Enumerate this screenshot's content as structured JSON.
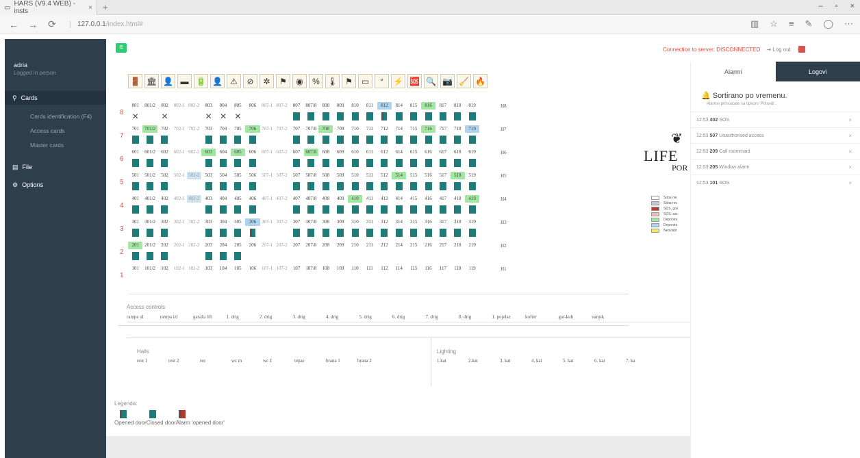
{
  "browser": {
    "tab_title": "HARS (V9.4 WEB) - insts",
    "tab_close": "×",
    "new_tab": "+",
    "url_host": "127.0.0.1",
    "url_path": "/index.html#",
    "back": "←",
    "forward": "→",
    "refresh": "⟳",
    "win_min": "–",
    "win_max": "▫",
    "win_close": "×"
  },
  "sidebar": {
    "user_name": "adria",
    "user_status": "Logged in person",
    "menu": [
      {
        "label": "Cards",
        "icon": "search-icon",
        "glyph": "🔍"
      },
      {
        "label": "Cards identification (F4)"
      },
      {
        "label": "Access cards"
      },
      {
        "label": "Master cards"
      },
      {
        "label": "File",
        "icon": "file-icon",
        "glyph": "▤"
      },
      {
        "label": "Options",
        "icon": "gear-icon",
        "glyph": "⚙"
      }
    ]
  },
  "header": {
    "connection_status": "Connection to server: DISCONNECTED",
    "logout_label": "Log out"
  },
  "toolbar_icons": [
    "door-icon",
    "building-icon",
    "person-icon",
    "bed-icon",
    "battery-icon",
    "person-icon",
    "warning-icon",
    "no-entry-icon",
    "fan-icon",
    "flag-icon",
    "dial-icon",
    "percent-icon",
    "thermo-icon",
    "flag-icon",
    "window-icon",
    "temp-icon",
    "lightning-icon",
    "sos-icon",
    "magnify-icon",
    "camera-icon",
    "maid-icon",
    "fire-icon"
  ],
  "floors": [
    {
      "floor": "8",
      "code": "H8",
      "rooms": [
        "801",
        "801/2",
        "802",
        "802-1",
        "802-2",
        "803",
        "804",
        "805",
        "806",
        "807-1",
        "807-2",
        "807",
        "807/8",
        "808",
        "809",
        "810",
        "811",
        "812",
        "814",
        "815",
        "816",
        "817",
        "818",
        "819"
      ],
      "hl": {
        "17": "b",
        "20": "g"
      }
    },
    {
      "floor": "7",
      "code": "H7",
      "rooms": [
        "701",
        "701/2",
        "702",
        "702-1",
        "702-2",
        "703",
        "704",
        "705",
        "706",
        "707-1",
        "707-2",
        "707",
        "707/8",
        "708",
        "709",
        "710",
        "711",
        "712",
        "714",
        "715",
        "716",
        "717",
        "718",
        "719"
      ],
      "hl": {
        "1": "g",
        "8": "g",
        "13": "g",
        "20": "g",
        "23": "b"
      }
    },
    {
      "floor": "6",
      "code": "H6",
      "rooms": [
        "601",
        "601/2",
        "602",
        "602-1",
        "602-2",
        "603",
        "604",
        "605",
        "606",
        "607-1",
        "607-2",
        "607",
        "607/8",
        "608",
        "609",
        "610",
        "611",
        "612",
        "614",
        "615",
        "616",
        "617",
        "618",
        "619"
      ],
      "hl": {
        "5": "g",
        "7": "g",
        "12": "g"
      }
    },
    {
      "floor": "5",
      "code": "H5",
      "rooms": [
        "501",
        "501/2",
        "502",
        "502-1",
        "502-2",
        "503",
        "504",
        "505",
        "506",
        "507-1",
        "507-2",
        "507",
        "507/8",
        "508",
        "509",
        "510",
        "511",
        "512",
        "514",
        "515",
        "516",
        "517",
        "518",
        "519"
      ],
      "hl": {
        "4": "lb",
        "18": "g",
        "22": "g"
      }
    },
    {
      "floor": "4",
      "code": "H4",
      "rooms": [
        "401",
        "401/2",
        "402",
        "402-1",
        "402-2",
        "403",
        "404",
        "405",
        "406",
        "407-1",
        "407-2",
        "407",
        "407/8",
        "408",
        "409",
        "410",
        "411",
        "412",
        "414",
        "415",
        "416",
        "417",
        "418",
        "419"
      ],
      "hl": {
        "4": "lb",
        "15": "g",
        "23": "g"
      }
    },
    {
      "floor": "3",
      "code": "H3",
      "rooms": [
        "301",
        "301/2",
        "302",
        "302-1",
        "302-2",
        "303",
        "304",
        "305",
        "306",
        "307-1",
        "307-2",
        "307",
        "307/8",
        "308",
        "309",
        "310",
        "311",
        "312",
        "314",
        "315",
        "316",
        "317",
        "318",
        "319"
      ],
      "hl": {
        "8": "b"
      }
    },
    {
      "floor": "2",
      "code": "H2",
      "rooms": [
        "201",
        "201/2",
        "202",
        "202-1",
        "202-2",
        "203",
        "204",
        "205",
        "206",
        "207-1",
        "207-2",
        "207",
        "207/8",
        "208",
        "209",
        "210",
        "211",
        "212",
        "214",
        "215",
        "216",
        "217",
        "218",
        "219"
      ],
      "hl": {
        "0": "g"
      }
    },
    {
      "floor": "1",
      "code": "H1",
      "rooms": [
        "101",
        "101/2",
        "102",
        "102-1",
        "102-2",
        "103",
        "104",
        "105",
        "106",
        "107-1",
        "107-2",
        "107",
        "107/8",
        "108",
        "109",
        "110",
        "111",
        "112",
        "114",
        "115",
        "116",
        "117",
        "118",
        "119"
      ],
      "hl": {}
    }
  ],
  "access_controls": {
    "title": "Access controls",
    "items": [
      "rampa ul",
      "rampa izl",
      "garaža lift",
      "1. drig",
      "2. drig",
      "3. drig",
      "4. drig",
      "5. drig",
      "6. drig",
      "7. drig",
      "8. drig",
      "1. pojelaz",
      "kofter",
      "gar-kuh",
      "vanjsk"
    ]
  },
  "halls": {
    "title": "Halls",
    "items": [
      "rest 1",
      "rest 2",
      "rec",
      "wc m",
      "wc ž",
      "tepas",
      "brana 1",
      "brana 2"
    ]
  },
  "lighting": {
    "title": "Lighting",
    "items": [
      "1.kat",
      "2.kat",
      "3. kat",
      "4. kat",
      "5. kat",
      "6. kat",
      "7. ka"
    ]
  },
  "legend": {
    "title": "Legenda:",
    "text": "Opened doorClosed doorAlarm 'opened door'",
    "colors": {
      "open": "#1f7c78",
      "closed": "#1f7c78",
      "alarm": "#b03b2d"
    }
  },
  "logo": {
    "glyph": "❦",
    "line1": "LIFE",
    "line2": "POR"
  },
  "color_legend": [
    {
      "label": "Soba nie",
      "color": "#ffffff"
    },
    {
      "label": "Soba rev",
      "color": "#c8c0dd"
    },
    {
      "label": "SOS, gos",
      "color": "#c0392b"
    },
    {
      "label": "SOS, sar",
      "color": "#f7b6c2"
    },
    {
      "label": "Deponira",
      "color": "#a2e6a2"
    },
    {
      "label": "Deponira",
      "color": "#aed3ee"
    },
    {
      "label": "Neovlašt",
      "color": "#f4ea5a"
    }
  ],
  "right_panel": {
    "tab_alarms": "Alarmi",
    "tab_logs": "Logovi",
    "sort_title": "Sortirano po vremenu.",
    "sort_sub": "Alarme prihvaćate sa tipkom 'Prihvati'.",
    "alarms": [
      {
        "time": "12:53",
        "room": "402",
        "text": "SOS"
      },
      {
        "time": "12:53",
        "room": "507",
        "text": "Unauthorised access"
      },
      {
        "time": "12:53",
        "room": "209",
        "text": "Call roommaid"
      },
      {
        "time": "12:53",
        "room": "205",
        "text": "Window alarm"
      },
      {
        "time": "12:53",
        "room": "101",
        "text": "SOS"
      }
    ]
  }
}
